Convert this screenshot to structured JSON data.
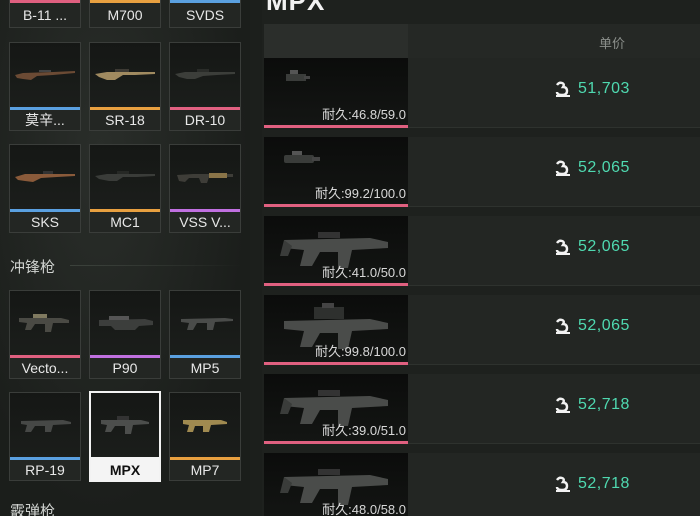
{
  "left_panel": {
    "top_row": [
      {
        "name": "B-11 ...",
        "rarity_color": "#e06080"
      },
      {
        "name": "M700",
        "rarity_color": "#e8a040"
      },
      {
        "name": "SVDS",
        "rarity_color": "#5aa0e0"
      }
    ],
    "sniper_row1": [
      {
        "name": "莫辛...",
        "rarity_color": "#5aa0e0"
      },
      {
        "name": "SR-18",
        "rarity_color": "#e8a040"
      },
      {
        "name": "DR-10",
        "rarity_color": "#e06080"
      }
    ],
    "sniper_row2": [
      {
        "name": "SKS",
        "rarity_color": "#5aa0e0"
      },
      {
        "name": "MC1",
        "rarity_color": "#e8a040"
      },
      {
        "name": "VSS V...",
        "rarity_color": "#c070e0"
      }
    ],
    "smg_category": "冲锋枪",
    "smg_row1": [
      {
        "name": "Vecto...",
        "rarity_color": "#e06080"
      },
      {
        "name": "P90",
        "rarity_color": "#c070e0"
      },
      {
        "name": "MP5",
        "rarity_color": "#5aa0e0"
      }
    ],
    "smg_row2": [
      {
        "name": "RP-19",
        "rarity_color": "#5aa0e0"
      },
      {
        "name": "MPX",
        "rarity_color": "#f4f4f4",
        "selected": true
      },
      {
        "name": "MP7",
        "rarity_color": "#e8a040"
      }
    ],
    "next_category": "霰弹枪"
  },
  "market": {
    "title": "MPX",
    "price_header": "单价",
    "coin_icon": "currency-coin-icon",
    "listings": [
      {
        "durability": "耐久:46.8/59.0",
        "price": "51,703",
        "variant": "scope"
      },
      {
        "durability": "耐久:99.2/100.0",
        "price": "52,065",
        "variant": "sight"
      },
      {
        "durability": "耐久:41.0/50.0",
        "price": "52,065",
        "variant": "smg"
      },
      {
        "durability": "耐久:99.8/100.0",
        "price": "52,065",
        "variant": "smg-scoped"
      },
      {
        "durability": "耐久:39.0/51.0",
        "price": "52,718",
        "variant": "smg"
      },
      {
        "durability": "耐久:48.0/58.0",
        "price": "52,718",
        "variant": "smg"
      }
    ],
    "accent_color": "#4fd9b0",
    "listing_rarity_color": "#e06080"
  }
}
